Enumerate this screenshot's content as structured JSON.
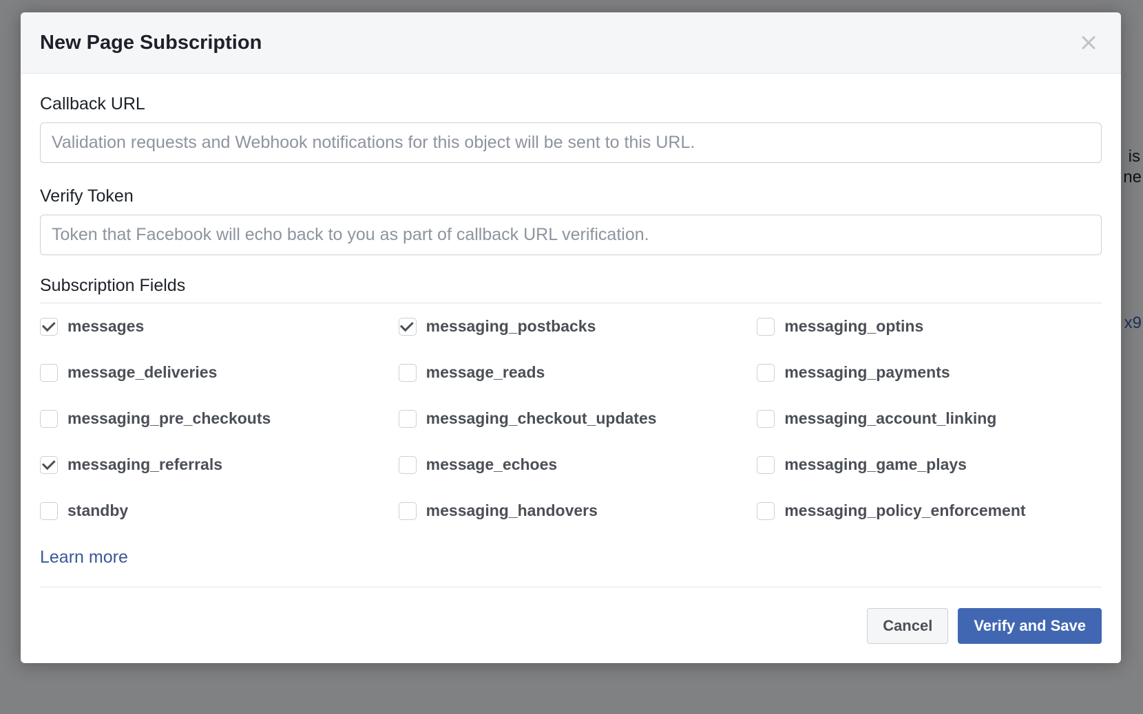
{
  "background": {
    "frag1": "is",
    "frag2": "ne",
    "frag3": "x9"
  },
  "modal": {
    "title": "New Page Subscription",
    "callback_label": "Callback URL",
    "callback_placeholder": "Validation requests and Webhook notifications for this object will be sent to this URL.",
    "verify_label": "Verify Token",
    "verify_placeholder": "Token that Facebook will echo back to you as part of callback URL verification.",
    "subscription_fields_label": "Subscription Fields",
    "fields": [
      {
        "name": "messages",
        "checked": true
      },
      {
        "name": "messaging_postbacks",
        "checked": true
      },
      {
        "name": "messaging_optins",
        "checked": false
      },
      {
        "name": "message_deliveries",
        "checked": false
      },
      {
        "name": "message_reads",
        "checked": false
      },
      {
        "name": "messaging_payments",
        "checked": false
      },
      {
        "name": "messaging_pre_checkouts",
        "checked": false
      },
      {
        "name": "messaging_checkout_updates",
        "checked": false
      },
      {
        "name": "messaging_account_linking",
        "checked": false
      },
      {
        "name": "messaging_referrals",
        "checked": true
      },
      {
        "name": "message_echoes",
        "checked": false
      },
      {
        "name": "messaging_game_plays",
        "checked": false
      },
      {
        "name": "standby",
        "checked": false
      },
      {
        "name": "messaging_handovers",
        "checked": false
      },
      {
        "name": "messaging_policy_enforcement",
        "checked": false
      }
    ],
    "learn_more": "Learn more",
    "cancel": "Cancel",
    "verify_save": "Verify and Save"
  }
}
